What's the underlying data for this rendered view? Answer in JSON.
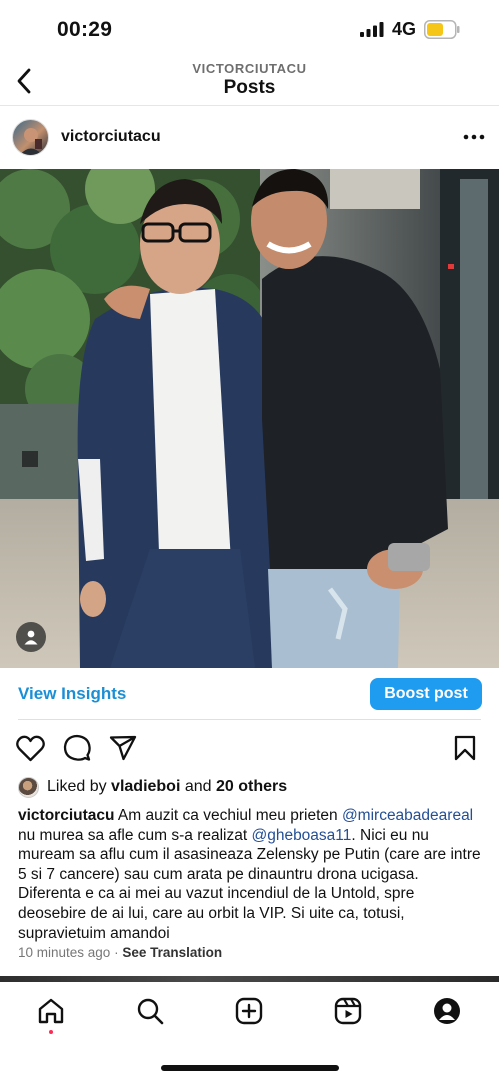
{
  "status_bar": {
    "time": "00:29",
    "network": "4G"
  },
  "header": {
    "subtitle": "VICTORCIUTACU",
    "title": "Posts"
  },
  "post": {
    "username": "victorciutacu",
    "insights_label": "View Insights",
    "boost_label": "Boost post",
    "likes": {
      "prefix": "Liked by",
      "user": "vladieboi",
      "and": "and",
      "others": "20 others"
    },
    "caption": {
      "author": "victorciutacu",
      "part1": " Am auzit ca vechiul meu prieten ",
      "mention1": "@mirceabadeareal",
      "part2": " nu murea sa afle cum s-a realizat ",
      "mention2": "@gheboasa11",
      "part3": ". Nici eu nu muream sa aflu cum il asasineaza Zelensky pe Putin (care are intre 5 si 7 cancere) sau cum arata pe dinauntru drona ucigasa. Diferenta e ca ai mei au vazut incendiul de la Untold, spre deosebire de ai lui, care au orbit la VIP. Si uite ca, totusi, supravietuim amandoi"
    },
    "time_ago": "10 minutes ago",
    "separator": "·",
    "see_translation": "See Translation"
  },
  "colors": {
    "link": "#1b8fd6",
    "boost": "#1f9bf0",
    "mention": "#244f94",
    "battery": "#f5c518",
    "active_dot": "#ff2b55"
  },
  "icons": [
    "back-arrow-icon",
    "more-icon",
    "person-tag-icon",
    "heart-icon",
    "comment-icon",
    "share-icon",
    "bookmark-icon",
    "home-icon",
    "search-icon",
    "create-icon",
    "reels-icon",
    "profile-icon"
  ]
}
